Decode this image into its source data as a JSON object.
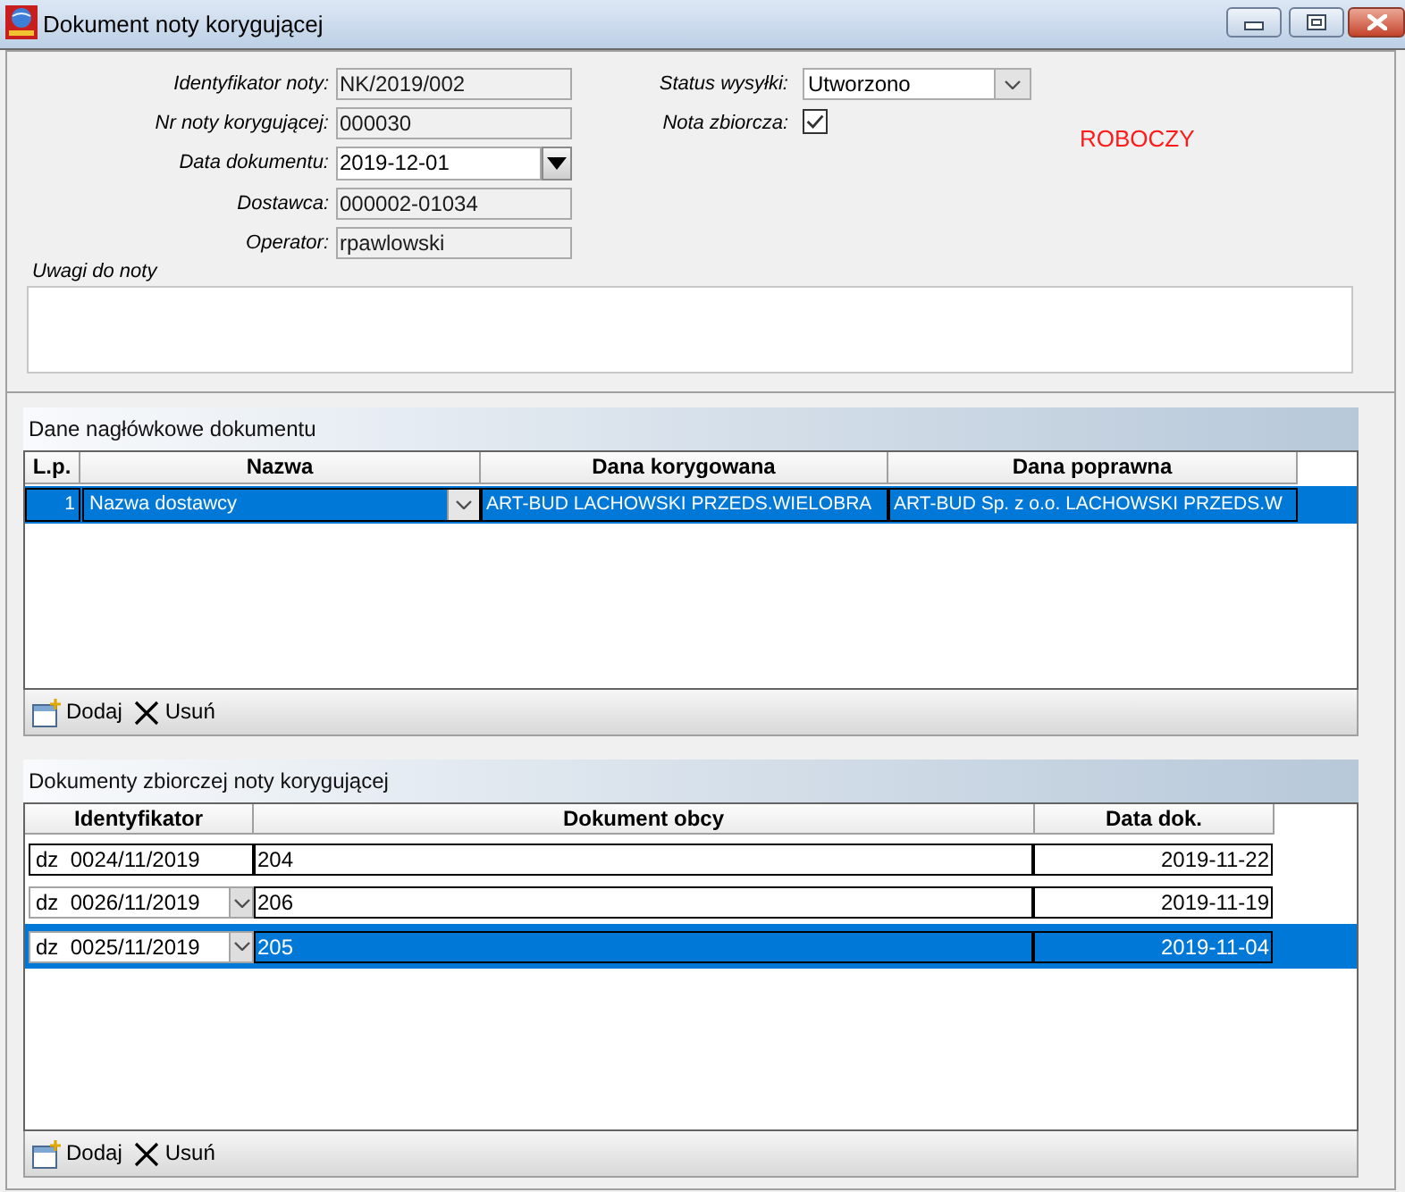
{
  "window": {
    "title": "Dokument noty korygującej"
  },
  "form": {
    "fields": [
      {
        "label": "Identyfikator noty:",
        "value": "NK/2019/002",
        "kind": "readonly"
      },
      {
        "label": "Nr noty korygującej:",
        "value": "000030",
        "kind": "readonly"
      },
      {
        "label": "Data dokumentu:",
        "value": "2019-12-01",
        "kind": "date"
      },
      {
        "label": "Dostawca:",
        "value": "000002-01034",
        "kind": "readonly"
      },
      {
        "label": "Operator:",
        "value": "rpawlowski",
        "kind": "readonly"
      }
    ],
    "status": {
      "label": "Status wysyłki:",
      "value": "Utworzono"
    },
    "collective_note": {
      "label": "Nota zbiorcza:",
      "checked": true
    },
    "document_state": "ROBOCZY",
    "notes": {
      "label": "Uwagi do noty"
    }
  },
  "header_data": {
    "title": "Dane nagłówkowe dokumentu",
    "columns": [
      "L.p.",
      "Nazwa",
      "Dana korygowana",
      "Dana poprawna"
    ],
    "rows": [
      {
        "lp": "1",
        "name": "Nazwa dostawcy",
        "corrected_value": "ART-BUD LACHOWSKI PRZEDS.WIELOBRA",
        "correct_value": "ART-BUD Sp. z o.o. LACHOWSKI PRZEDS.W",
        "selected": true
      }
    ],
    "toolbar": [
      {
        "label": "Dodaj",
        "kind": "add"
      },
      {
        "label": "Usuń",
        "kind": "delete"
      }
    ]
  },
  "documents": {
    "title": "Dokumenty zbiorczej noty korygującej",
    "columns": [
      "Identyfikator",
      "Dokument obcy",
      "Data dok."
    ],
    "rows": [
      {
        "identifier": "dz  0024/11/2019",
        "kind": "edit",
        "foreign_document": "204",
        "date": "2019-11-22",
        "selected": false
      },
      {
        "identifier": "dz  0026/11/2019",
        "kind": "combo",
        "foreign_document": "206",
        "date": "2019-11-19",
        "selected": false
      },
      {
        "identifier": "dz  0025/11/2019",
        "kind": "combo",
        "foreign_document": "205",
        "date": "2019-11-04",
        "selected": true
      }
    ],
    "toolbar": [
      {
        "label": "Dodaj",
        "kind": "add"
      },
      {
        "label": "Usuń",
        "kind": "delete"
      }
    ]
  }
}
